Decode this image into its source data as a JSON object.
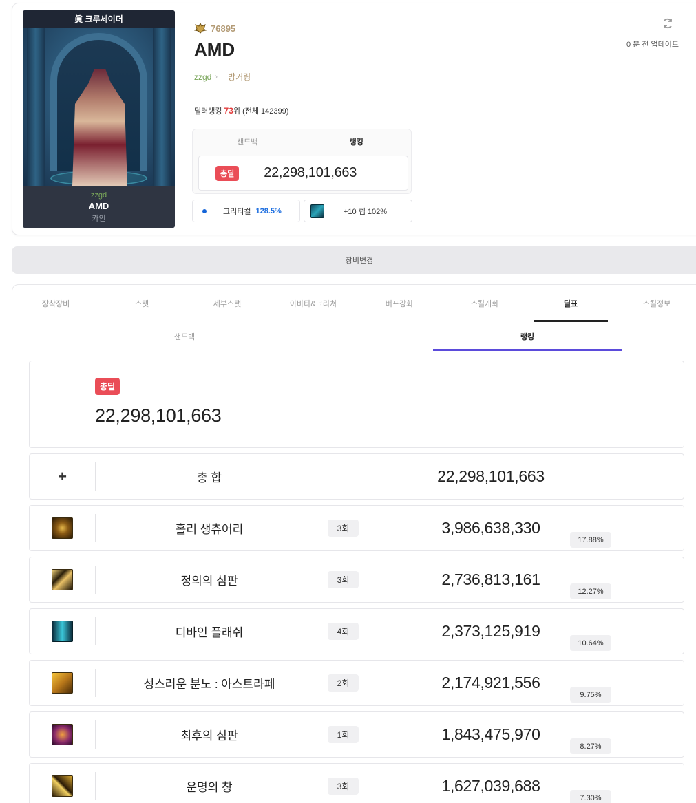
{
  "character": {
    "server_label": "眞 크루세이더",
    "guild": "zzgd",
    "name": "AMD",
    "server": "카인"
  },
  "profile": {
    "fame": "76895",
    "name": "AMD",
    "guild_link": "zzgd",
    "adventure_link": "방커링",
    "rank_prefix": "딜러랭킹 ",
    "rank_value": "73",
    "rank_suffix": "위 (전체 142399)",
    "update_text": "0 분 전 업데이트"
  },
  "score_box": {
    "tabs": [
      "샌드백",
      "랭킹"
    ],
    "active_tab": "랭킹",
    "badge": "총딜",
    "value": "22,298,101,663"
  },
  "mini_stats": {
    "crit_label": "크리티컬",
    "crit_value": "128.5%",
    "enhance_label": "+10 렙 102%"
  },
  "equip_change_label": "장비변경",
  "tabs": [
    "장착장비",
    "스탯",
    "세부스탯",
    "아바타&크리쳐",
    "버프강화",
    "스킬개화",
    "딜표",
    "스킬정보"
  ],
  "active_tab": "딜표",
  "subtabs": [
    "샌드백",
    "랭킹"
  ],
  "active_subtab": "랭킹",
  "total_card": {
    "badge": "총딜",
    "value": "22,298,101,663"
  },
  "total_row": {
    "icon": "plus-icon",
    "label": "총 합",
    "value": "22,298,101,663"
  },
  "skills": [
    {
      "name": "홀리 생츄어리",
      "count": "3회",
      "damage": "3,986,638,330",
      "percent": "17.88%",
      "icon": "holy-sanctuary-icon"
    },
    {
      "name": "정의의 심판",
      "count": "3회",
      "damage": "2,736,813,161",
      "percent": "12.27%",
      "icon": "judgement-icon"
    },
    {
      "name": "디바인 플래쉬",
      "count": "4회",
      "damage": "2,373,125,919",
      "percent": "10.64%",
      "icon": "divine-flash-icon"
    },
    {
      "name": "성스러운 분노 : 아스트라페",
      "count": "2회",
      "damage": "2,174,921,556",
      "percent": "9.75%",
      "icon": "astrape-icon"
    },
    {
      "name": "최후의 심판",
      "count": "1회",
      "damage": "1,843,475,970",
      "percent": "8.27%",
      "icon": "final-judgement-icon"
    },
    {
      "name": "운명의 창",
      "count": "3회",
      "damage": "1,627,039,688",
      "percent": "7.30%",
      "icon": "spear-of-destiny-icon"
    }
  ],
  "colors": {
    "accent_red": "#ea4d57",
    "subtab_underline": "#5b4bdb",
    "crit_blue": "#1e6fe0",
    "fame_gold": "#b39b76",
    "guild_green": "#7aa65a"
  }
}
